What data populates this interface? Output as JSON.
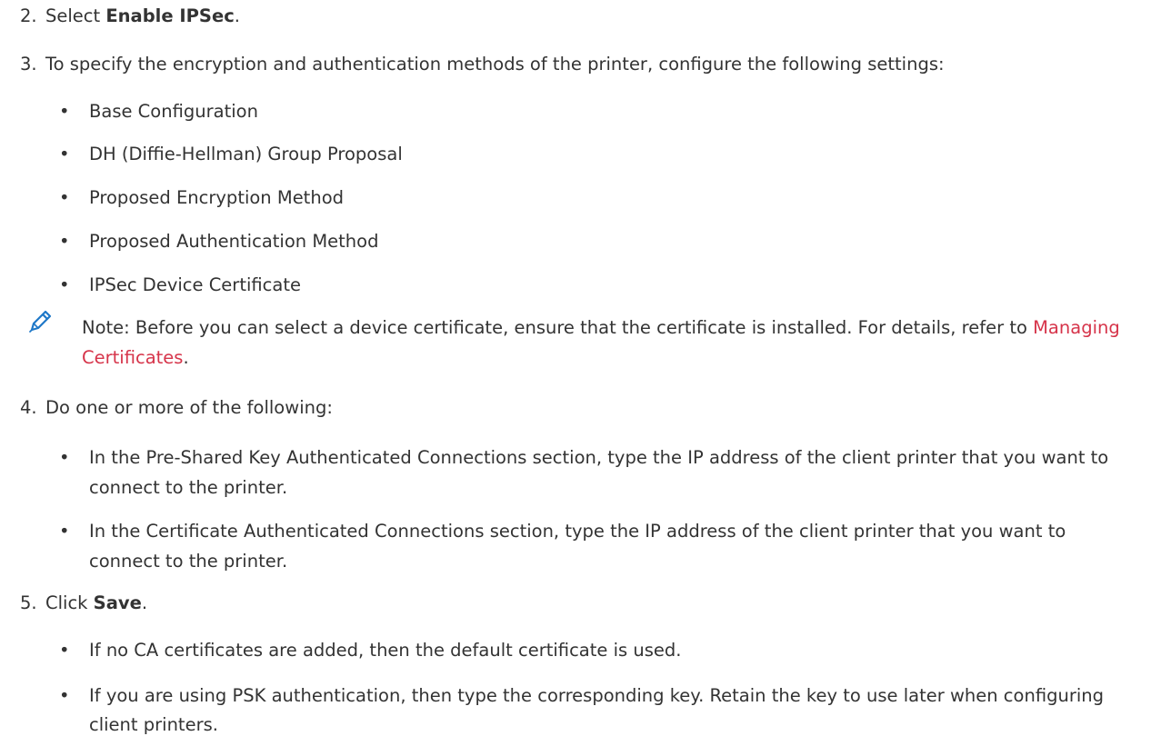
{
  "steps": [
    {
      "num": "2.",
      "pre": "Select ",
      "bold": "Enable IPSec",
      "post": "."
    },
    {
      "num": "3.",
      "text": "To specify the encryption and authentication methods of the printer, configure the following settings:"
    },
    {
      "num": "4.",
      "text": "Do one or more of the following:"
    },
    {
      "num": "5.",
      "pre": "Click ",
      "bold": "Save",
      "post": "."
    }
  ],
  "step3_bullets": [
    "Base Configuration",
    "DH (Diffie-Hellman) Group Proposal",
    "Proposed Encryption Method",
    "Proposed Authentication Method",
    "IPSec Device Certificate"
  ],
  "note": {
    "icon": "pencil-icon",
    "text": "Note: Before you can select a device certificate, ensure that the certificate is installed. For details, refer to",
    "link": "Managing Certificates",
    "end": ".",
    "link_color": "#d6344a"
  },
  "step4_bullets": [
    "In the Pre-Shared Key Authenticated Connections section, type the IP address of the client printer that you want to connect to the printer.",
    "In the Certificate Authenticated Connections section, type the IP address of the client printer that you want to connect to the printer."
  ],
  "step5_bullets": [
    "If no CA certificates are added, then the default certificate is used.",
    "If you are using PSK authentication, then type the corresponding key. Retain the key to use later when configuring client printers."
  ]
}
